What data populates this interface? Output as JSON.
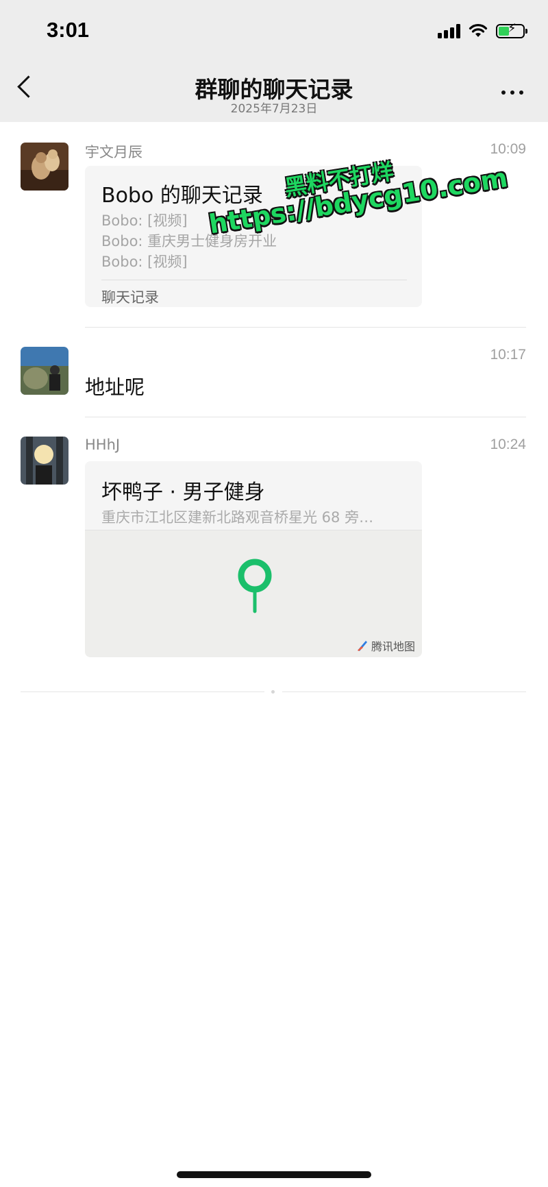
{
  "status_bar": {
    "time": "3:01"
  },
  "header": {
    "title": "群聊的聊天记录",
    "date": "2025年7月23日"
  },
  "messages": [
    {
      "sender": "宇文月辰",
      "time": "10:09",
      "card": {
        "title": "Bobo 的聊天记录",
        "lines": [
          "Bobo: [视频]",
          "Bobo: 重庆男士健身房开业",
          "Bobo: [视频]"
        ],
        "footer": "聊天记录"
      }
    },
    {
      "sender": "",
      "time": "10:17",
      "text": "地址呢"
    },
    {
      "sender": "HHhJ",
      "time": "10:24",
      "location": {
        "name": "坏鸭子 · 男子健身",
        "address": "重庆市江北区建新北路观音桥星光 68 旁…",
        "provider": "腾讯地图"
      }
    }
  ],
  "watermark": {
    "line1": "黑料不打烊",
    "line2": "https://bdycg10.com"
  },
  "colors": {
    "pin": "#1bbf6b",
    "watermark": "#1ed760",
    "header_bg": "#ededed"
  }
}
